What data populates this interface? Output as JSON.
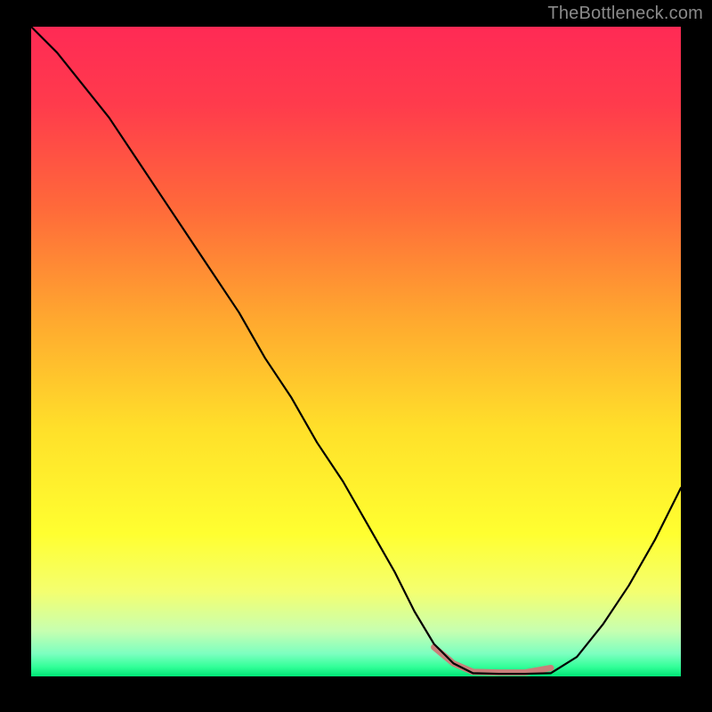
{
  "watermark": "TheBottleneck.com",
  "chart_data": {
    "type": "line",
    "title": "",
    "xlabel": "",
    "ylabel": "",
    "xlim": [
      0,
      100
    ],
    "ylim": [
      0,
      100
    ],
    "background_gradient_stops": [
      {
        "offset": 0.0,
        "color": "#ff2a55"
      },
      {
        "offset": 0.12,
        "color": "#ff3b4c"
      },
      {
        "offset": 0.28,
        "color": "#ff6a3a"
      },
      {
        "offset": 0.45,
        "color": "#ffa82f"
      },
      {
        "offset": 0.62,
        "color": "#ffe02a"
      },
      {
        "offset": 0.78,
        "color": "#ffff30"
      },
      {
        "offset": 0.87,
        "color": "#f4ff70"
      },
      {
        "offset": 0.93,
        "color": "#c7ffb0"
      },
      {
        "offset": 0.965,
        "color": "#7cffc0"
      },
      {
        "offset": 0.985,
        "color": "#33ff99"
      },
      {
        "offset": 1.0,
        "color": "#00e676"
      }
    ],
    "series": [
      {
        "name": "bottleneck-curve",
        "stroke": "#000000",
        "stroke_width": 2.2,
        "x": [
          0,
          4,
          8,
          12,
          16,
          20,
          24,
          28,
          32,
          36,
          40,
          44,
          48,
          52,
          56,
          59,
          62,
          65,
          68,
          72,
          76,
          80,
          84,
          88,
          92,
          96,
          100
        ],
        "y": [
          100,
          96,
          91,
          86,
          80,
          74,
          68,
          62,
          56,
          49,
          43,
          36,
          30,
          23,
          16,
          10,
          5,
          2,
          0.5,
          0.4,
          0.4,
          0.5,
          3,
          8,
          14,
          21,
          29
        ]
      }
    ],
    "flat_bottom_marker": {
      "stroke": "#c97f7a",
      "stroke_width": 7,
      "x": [
        62,
        65,
        68,
        72,
        76,
        80
      ],
      "y": [
        4.5,
        2.0,
        0.7,
        0.6,
        0.6,
        1.3
      ]
    }
  }
}
